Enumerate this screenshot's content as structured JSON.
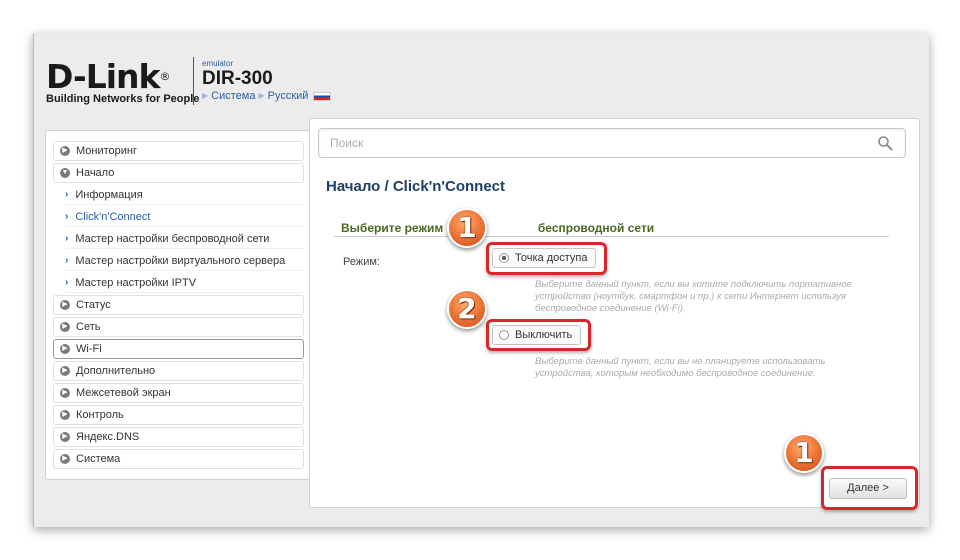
{
  "header": {
    "logo_text": "D-Link",
    "logo_reg": "®",
    "tagline": "Building Networks for People",
    "emulator": "emulator",
    "model": "DIR-300",
    "crumb_system": "Система",
    "crumb_language": "Русский"
  },
  "sidebar": {
    "items": [
      {
        "label": "Мониторинг",
        "type": "top",
        "icon": "expand-icon"
      },
      {
        "label": "Начало",
        "type": "top",
        "icon": "collapse-icon"
      },
      {
        "label": "Информация",
        "type": "sub"
      },
      {
        "label": "Click'n'Connect",
        "type": "sub",
        "active": true
      },
      {
        "label": "Мастер настройки беспроводной сети",
        "type": "sub"
      },
      {
        "label": "Мастер настройки виртуального сервера",
        "type": "sub"
      },
      {
        "label": "Мастер настройки IPTV",
        "type": "sub"
      },
      {
        "label": "Статус",
        "type": "top",
        "icon": "expand-icon"
      },
      {
        "label": "Сеть",
        "type": "top",
        "icon": "expand-icon"
      },
      {
        "label": "Wi-Fi",
        "type": "top",
        "icon": "expand-icon",
        "selected": true
      },
      {
        "label": "Дополнительно",
        "type": "top",
        "icon": "expand-icon"
      },
      {
        "label": "Межсетевой экран",
        "type": "top",
        "icon": "expand-icon"
      },
      {
        "label": "Контроль",
        "type": "top",
        "icon": "expand-icon"
      },
      {
        "label": "Яндекс.DNS",
        "type": "top",
        "icon": "expand-icon"
      },
      {
        "label": "Система",
        "type": "top",
        "icon": "expand-icon"
      }
    ]
  },
  "search": {
    "placeholder": "Поиск",
    "value": ""
  },
  "main": {
    "title": "Начало /  Click'n'Connect",
    "section_title_left": "Выберите режим",
    "section_title_right": "беспроводной сети",
    "mode_label": "Режим:",
    "option_ap": {
      "label": "Точка доступа",
      "checked": true,
      "hint": "Выберите данный пункт, если вы хотите подключить портативное устройство (ноутбук, смартфон и пр.) к сети Интернет используя беспроводное соединение (Wi-Fi)."
    },
    "option_off": {
      "label": "Выключить",
      "checked": false,
      "hint": "Выберите данный пункт, если вы не планируете использовать устройства, которым необходимо беспроводное соединение."
    },
    "next_label": "Далее >"
  },
  "annotations": {
    "marker_1": "1",
    "marker_2": "2",
    "marker_3": "1",
    "highlight_color": "#d8262b",
    "marker_color": "#f07a3b"
  }
}
